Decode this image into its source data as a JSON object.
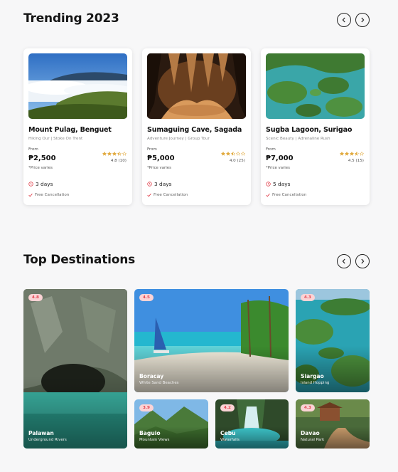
{
  "trending": {
    "title": "Trending 2023",
    "cards": [
      {
        "title": "Mount Pulag, Benguet",
        "subtitle": "Hiking Our | Stoke On Trent",
        "from": "From",
        "price": "₱2,500",
        "note": "*Price varies",
        "rating": "4.8 (10)",
        "stars": 3.5,
        "days": "3 days",
        "cancel": "Free Cancellation"
      },
      {
        "title": "Sumaguing Cave, Sagada",
        "subtitle": "Adventure Journey | Group Tour",
        "from": "From",
        "price": "₱5,000",
        "note": "*Price varies",
        "rating": "4.0 (25)",
        "stars": 2.5,
        "days": "3 days",
        "cancel": "Free Cancellation"
      },
      {
        "title": "Sugba Lagoon, Surigao",
        "subtitle": "Scenic Beauty | Adrenaline Rush",
        "from": "From",
        "price": "₱7,000",
        "note": "*Price varies",
        "rating": "4.5 (15)",
        "stars": 3.5,
        "days": "5 days",
        "cancel": "Free Cancellation"
      }
    ]
  },
  "destinations": {
    "title": "Top Destinations",
    "items": [
      {
        "badge": "4.8",
        "name": "Palawan",
        "tag": "Underground Rivers"
      },
      {
        "badge": "4.5",
        "name": "Boracay",
        "tag": "White Sand Beaches"
      },
      {
        "badge": "4.3",
        "name": "Siargao",
        "tag": "Island Hopping"
      },
      {
        "badge": "3.9",
        "name": "Baguio",
        "tag": "Mountain Views"
      },
      {
        "badge": "4.2",
        "name": "Cebu",
        "tag": "Waterfalls"
      },
      {
        "badge": "4.3",
        "name": "Davao",
        "tag": "Natural Park"
      }
    ]
  },
  "colors": {
    "accent": "#e2444f",
    "star": "#e0a83a",
    "badge_bg": "#fbd3d5"
  }
}
